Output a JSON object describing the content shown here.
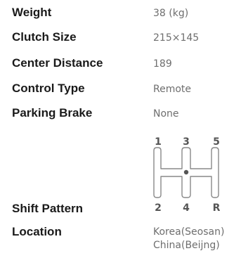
{
  "specs": {
    "weight": {
      "label": "Weight",
      "value": "38 (kg)"
    },
    "clutch_size": {
      "label": "Clutch Size",
      "value": "215×145"
    },
    "center_distance": {
      "label": "Center Distance",
      "value": "189"
    },
    "control_type": {
      "label": "Control Type",
      "value": "Remote"
    },
    "parking_brake": {
      "label": "Parking Brake",
      "value": "None"
    },
    "shift_pattern": {
      "label": "Shift Pattern",
      "gears_top": [
        "1",
        "3",
        "5"
      ],
      "gears_bottom": [
        "2",
        "4",
        "R"
      ]
    },
    "location": {
      "label": "Location",
      "value_line1": "Korea(Seosan)",
      "value_line2": "China(Beijng)"
    }
  },
  "colors": {
    "label": "#1a1a1a",
    "value": "#6e6e6e",
    "diagram": "#888888"
  }
}
